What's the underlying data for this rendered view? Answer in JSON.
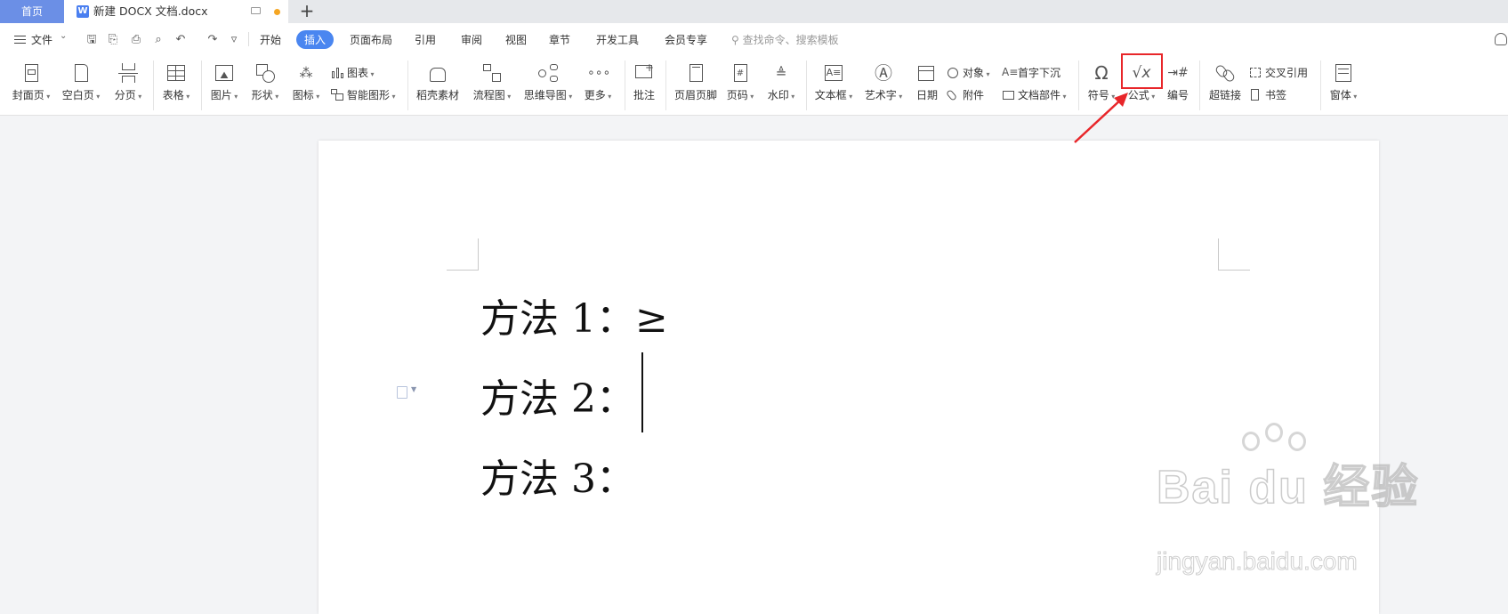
{
  "tabs": {
    "home": "首页",
    "document": "新建 DOCX 文档.docx",
    "new_tab": "+"
  },
  "menu": {
    "file": "文件",
    "tabs": [
      "开始",
      "插入",
      "页面布局",
      "引用",
      "审阅",
      "视图",
      "章节",
      "开发工具",
      "会员专享"
    ],
    "active_tab": "插入",
    "search_placeholder": "查找命令、搜索模板"
  },
  "ribbon": {
    "cover": "封面页",
    "blank_page": "空白页",
    "page_break": "分页",
    "table": "表格",
    "picture": "图片",
    "shape": "形状",
    "icon": "图标",
    "chart": "图表",
    "smart_art": "智能图形",
    "stock_material": "稻壳素材",
    "flowchart": "流程图",
    "mindmap": "思维导图",
    "more": "更多",
    "comment": "批注",
    "header_footer": "页眉页脚",
    "page_number": "页码",
    "watermark": "水印",
    "text_box": "文本框",
    "word_art": "艺术字",
    "date": "日期",
    "object": "对象",
    "attachment": "附件",
    "drop_cap": "首字下沉",
    "doc_parts": "文档部件",
    "symbol": "符号",
    "formula": "公式",
    "numbering": "编号",
    "hyperlink": "超链接",
    "cross_ref": "交叉引用",
    "bookmark": "书签",
    "window": "窗体"
  },
  "document": {
    "lines": [
      "方法 1：≥",
      "方法 2：",
      "方法 3："
    ]
  },
  "watermark": {
    "brand": "Bai du 经验",
    "url": "jingyan.baidu.com"
  },
  "colors": {
    "accent": "#4a86f0",
    "highlight": "#e8262a"
  }
}
